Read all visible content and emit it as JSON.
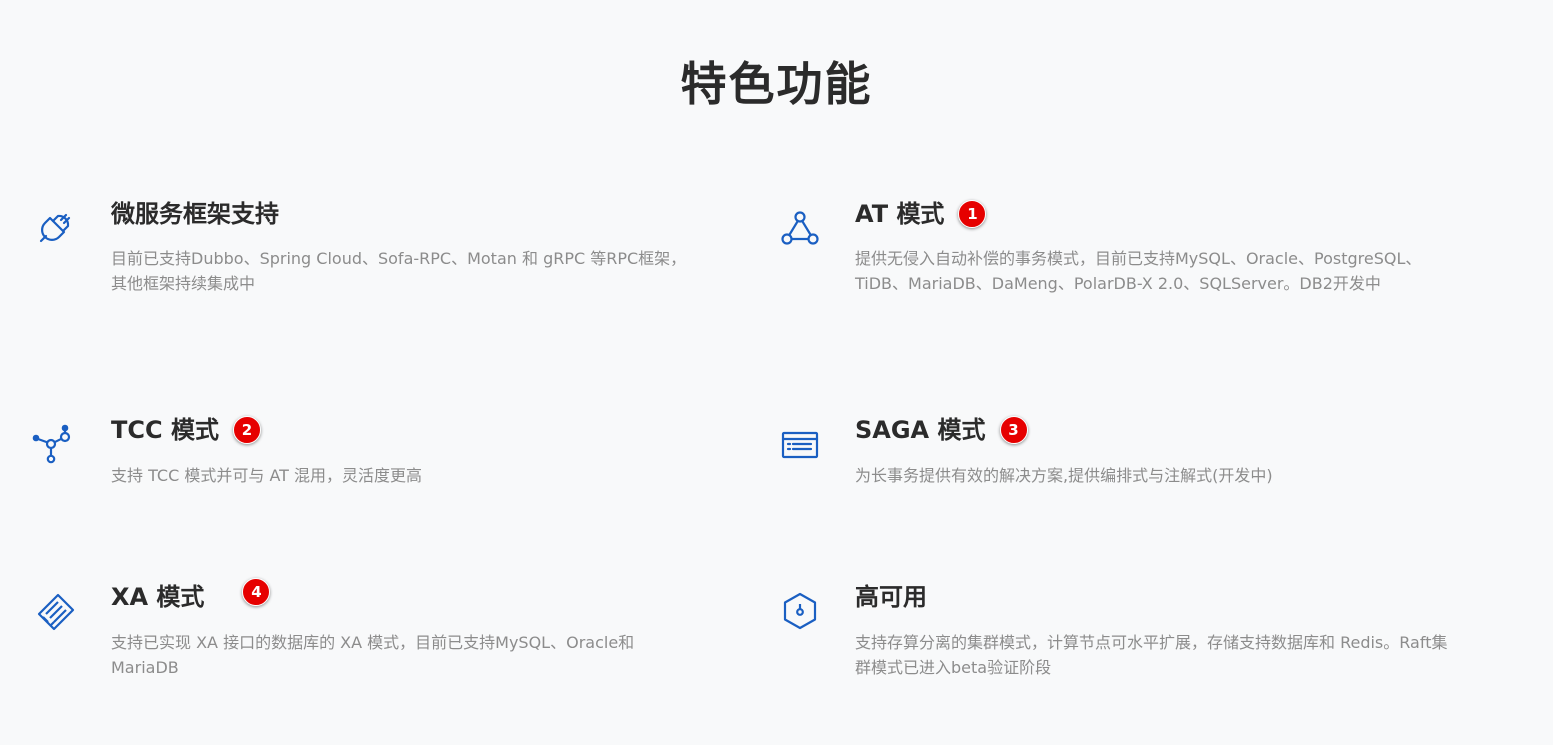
{
  "section": {
    "title": "特色功能"
  },
  "features": [
    {
      "title": "微服务框架支持",
      "desc": "目前已支持Dubbo、Spring Cloud、Sofa-RPC、Motan 和 gRPC 等RPC框架，其他框架持续集成中",
      "icon": "plug-icon"
    },
    {
      "title": "AT 模式",
      "badge": "1",
      "desc": "提供无侵入自动补偿的事务模式，目前已支持MySQL、Oracle、PostgreSQL、TiDB、MariaDB、DaMeng、PolarDB-X 2.0、SQLServer。DB2开发中",
      "icon": "triangle-nodes-icon"
    },
    {
      "title": "TCC 模式",
      "badge": "2",
      "desc": "支持 TCC 模式并可与 AT 混用，灵活度更高",
      "icon": "molecule-nodes-icon"
    },
    {
      "title": "SAGA 模式",
      "badge": "3",
      "desc": "为长事务提供有效的解决方案,提供编排式与注解式(开发中)",
      "icon": "server-panel-icon"
    },
    {
      "title": "XA 模式",
      "badge": "4",
      "desc": "支持已实现 XA 接口的数据库的 XA 模式，目前已支持MySQL、Oracle和MariaDB",
      "icon": "memory-chip-icon"
    },
    {
      "title": "高可用",
      "desc": "支持存算分离的集群模式，计算节点可水平扩展，存储支持数据库和 Redis。Raft集群模式已进入beta验证阶段",
      "icon": "hexagon-icon"
    }
  ],
  "colors": {
    "icon": "#1a5fc2",
    "badge": "#e60000"
  }
}
